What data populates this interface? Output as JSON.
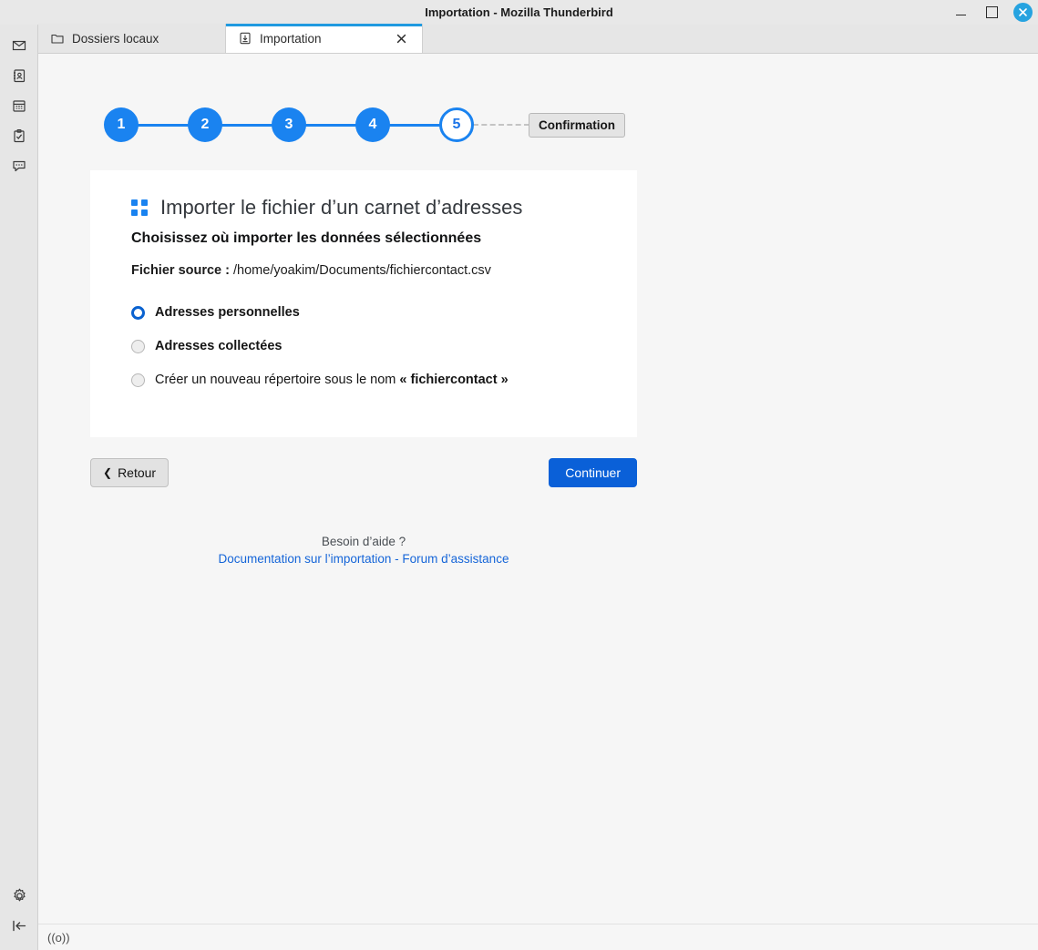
{
  "window": {
    "title": "Importation - Mozilla Thunderbird",
    "minimize_label": "−",
    "maximize_label": "□",
    "close_label": "✕"
  },
  "sidebar": {
    "top_items": [
      {
        "name": "mail-icon",
        "label": "Courrier"
      },
      {
        "name": "address-book-icon",
        "label": "Carnet d’adresses"
      },
      {
        "name": "calendar-icon",
        "label": "Agenda"
      },
      {
        "name": "tasks-icon",
        "label": "Tâches"
      },
      {
        "name": "chat-icon",
        "label": "Discussion"
      }
    ],
    "bottom_items": [
      {
        "name": "settings-gear-icon",
        "label": "Paramètres"
      },
      {
        "name": "collapse-sidebar-icon",
        "label": "Réduire"
      }
    ]
  },
  "tabs": [
    {
      "label": "Dossiers locaux",
      "icon": "folder-icon",
      "active": false
    },
    {
      "label": "Importation",
      "icon": "import-icon",
      "active": true,
      "close_label": "✕"
    }
  ],
  "stepper": {
    "steps": [
      "1",
      "2",
      "3",
      "4",
      "5"
    ],
    "current_index": 4,
    "badge_label": "Confirmation"
  },
  "card": {
    "title": "Importer le fichier d’un carnet d’adresses",
    "subtitle": "Choisissez où importer les données sélectionnées",
    "source_label": "Fichier source :",
    "source_value": "/home/yoakim/Documents/fichiercontact.csv",
    "options": [
      {
        "label": "Adresses personnelles",
        "selected": true,
        "bold": true
      },
      {
        "label": "Adresses collectées",
        "selected": false,
        "bold": true
      },
      {
        "label": "Créer un nouveau répertoire sous le nom ",
        "emphasis": "« fichiercontact »",
        "selected": false,
        "bold": false
      }
    ]
  },
  "buttons": {
    "back_label": "Retour",
    "back_chevron": "❮",
    "continue_label": "Continuer"
  },
  "help": {
    "title": "Besoin d’aide ?",
    "link_doc": "Documentation sur l’importation",
    "separator": "-",
    "link_forum": "Forum d’assistance"
  },
  "status_bar": {
    "sync_label": "((o))"
  },
  "colors": {
    "accent_blue": "#1a83f0",
    "button_blue": "#0a60d8",
    "link_blue": "#1565d8",
    "tab_active_underline": "#1f9ae0",
    "close_button": "#26a3e0",
    "content_bg": "#f6f6f6",
    "card_bg": "#ffffff",
    "chrome_bg": "#e6e6e6"
  }
}
